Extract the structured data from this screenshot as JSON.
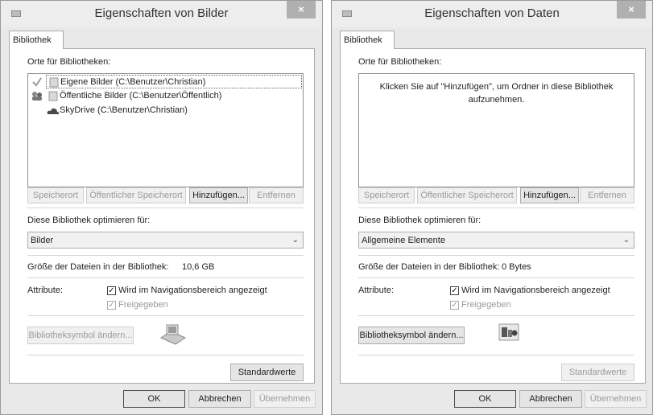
{
  "dialogs": [
    {
      "title": "Eigenschaften von Bilder",
      "close_label": "×",
      "tab": "Bibliothek",
      "locations_label": "Orte für Bibliotheken:",
      "locations": [
        {
          "text": "Eigene Bilder (C:\\Benutzer\\Christian)",
          "icon": "folder-icon",
          "marker": "default-save-check-icon"
        },
        {
          "text": "Öffentliche Bilder (C:\\Benutzer\\Öffentlich)",
          "icon": "folder-icon",
          "marker": "public-save-location-icon"
        },
        {
          "text": "SkyDrive (C:\\Benutzer\\Christian)",
          "icon": "skydrive-icon",
          "marker": ""
        }
      ],
      "buttons": {
        "speicherort": "Speicherort",
        "oeffentlicher": "Öffentlicher Speicherort",
        "hinzufuegen": "Hinzufügen...",
        "entfernen": "Entfernen"
      },
      "optimize_label": "Diese Bibliothek optimieren für:",
      "optimize_value": "Bilder",
      "size_label": "Größe der Dateien in der Bibliothek:",
      "size_value": "10,6 GB",
      "attributes_label": "Attribute:",
      "nav_checkbox_label": "Wird im Navigationsbereich angezeigt",
      "shared_checkbox_label": "Freigegeben",
      "change_icon_button": "Bibliotheksymbol ändern...",
      "defaults_button": "Standardwerte",
      "ok_button": "OK",
      "cancel_button": "Abbrechen",
      "apply_button": "Übernehmen"
    },
    {
      "title": "Eigenschaften von Daten",
      "close_label": "×",
      "tab": "Bibliothek",
      "locations_label": "Orte für Bibliotheken:",
      "empty_hint": "Klicken Sie auf \"Hinzufügen\", um Ordner in diese Bibliothek aufzunehmen.",
      "buttons": {
        "speicherort": "Speicherort",
        "oeffentlicher": "Öffentlicher Speicherort",
        "hinzufuegen": "Hinzufügen...",
        "entfernen": "Entfernen"
      },
      "optimize_label": "Diese Bibliothek optimieren für:",
      "optimize_value": "Allgemeine Elemente",
      "size_label": "Größe der Dateien in der Bibliothek:",
      "size_value": "0 Bytes",
      "attributes_label": "Attribute:",
      "nav_checkbox_label": "Wird im Navigationsbereich angezeigt",
      "shared_checkbox_label": "Freigegeben",
      "change_icon_button": "Bibliotheksymbol ändern...",
      "defaults_button": "Standardwerte",
      "ok_button": "OK",
      "cancel_button": "Abbrechen",
      "apply_button": "Übernehmen"
    }
  ]
}
